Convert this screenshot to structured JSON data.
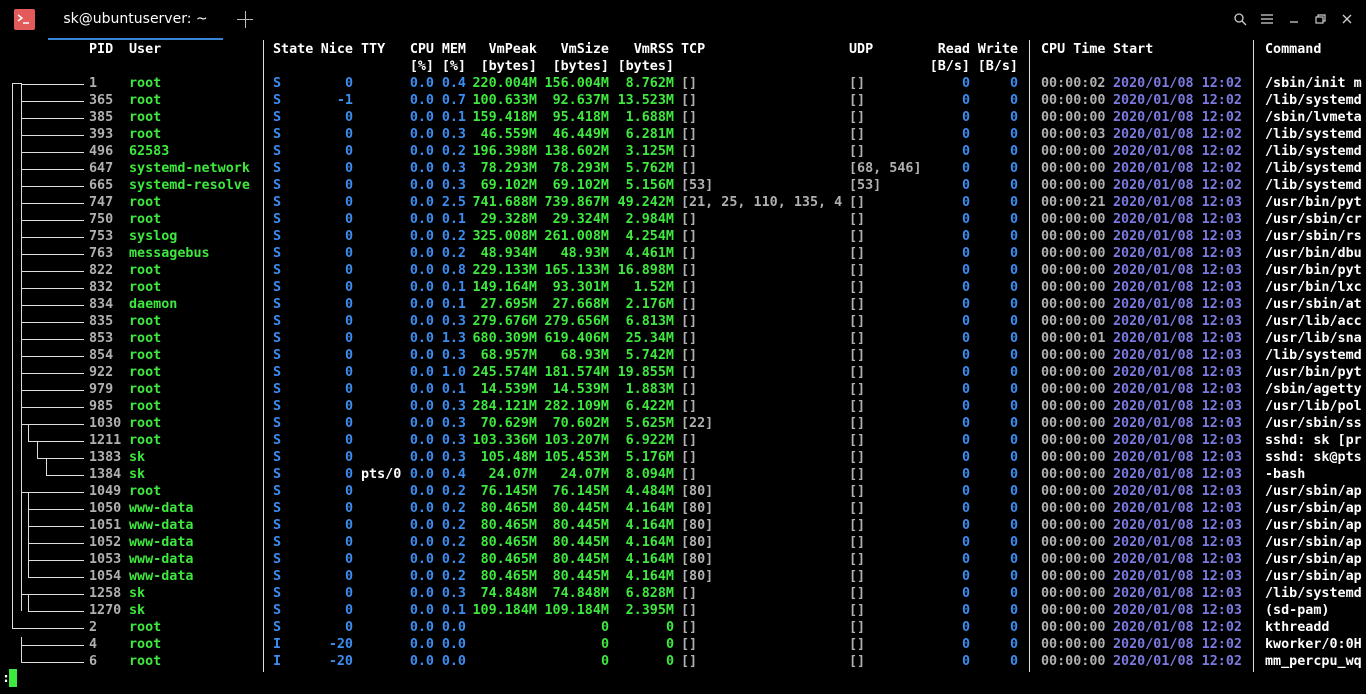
{
  "tab": {
    "title": "sk@ubuntuserver: ~"
  },
  "window_controls": {
    "search": "⌕",
    "menu": "☰",
    "minimize": "—",
    "maximize": "❐",
    "close": "✕"
  },
  "header_top": {
    "pid": "PID",
    "user": "User",
    "state": "State",
    "nice": "Nice",
    "tty": "TTY",
    "cpu": "CPU",
    "mem": "MEM",
    "vmpeak": "VmPeak",
    "vmsize": "VmSize",
    "vmrss": "VmRSS",
    "tcp": "TCP",
    "udp": "UDP",
    "read": "Read",
    "write": "Write",
    "cputime": "CPU Time",
    "start": "Start",
    "command": "Command"
  },
  "header_units": {
    "cpu": "[%]",
    "mem": "[%]",
    "vmpeak": "[bytes]",
    "vmsize": "[bytes]",
    "vmrss": "[bytes]",
    "read": "[B/s]",
    "write": "[B/s]"
  },
  "rows": [
    {
      "pid": "1",
      "user": "root",
      "state": "S",
      "nice": "0",
      "tty": "",
      "cpu": "0.0",
      "mem": "0.4",
      "vmpeak": "220.004M",
      "vmsize": "156.004M",
      "vmrss": "8.762M",
      "tcp": "[]",
      "udp": "[]",
      "read": "0",
      "write": "0",
      "cputime": "00:00:02",
      "start": "2020/01/08 12:02",
      "command": "/sbin/init m"
    },
    {
      "pid": "365",
      "user": "root",
      "state": "S",
      "nice": "-1",
      "tty": "",
      "cpu": "0.0",
      "mem": "0.7",
      "vmpeak": "100.633M",
      "vmsize": "92.637M",
      "vmrss": "13.523M",
      "tcp": "[]",
      "udp": "[]",
      "read": "0",
      "write": "0",
      "cputime": "00:00:00",
      "start": "2020/01/08 12:02",
      "command": "/lib/systemd"
    },
    {
      "pid": "385",
      "user": "root",
      "state": "S",
      "nice": "0",
      "tty": "",
      "cpu": "0.0",
      "mem": "0.1",
      "vmpeak": "159.418M",
      "vmsize": "95.418M",
      "vmrss": "1.688M",
      "tcp": "[]",
      "udp": "[]",
      "read": "0",
      "write": "0",
      "cputime": "00:00:00",
      "start": "2020/01/08 12:02",
      "command": "/sbin/lvmeta"
    },
    {
      "pid": "393",
      "user": "root",
      "state": "S",
      "nice": "0",
      "tty": "",
      "cpu": "0.0",
      "mem": "0.3",
      "vmpeak": "46.559M",
      "vmsize": "46.449M",
      "vmrss": "6.281M",
      "tcp": "[]",
      "udp": "[]",
      "read": "0",
      "write": "0",
      "cputime": "00:00:03",
      "start": "2020/01/08 12:02",
      "command": "/lib/systemd"
    },
    {
      "pid": "496",
      "user": "62583",
      "state": "S",
      "nice": "0",
      "tty": "",
      "cpu": "0.0",
      "mem": "0.2",
      "vmpeak": "196.398M",
      "vmsize": "138.602M",
      "vmrss": "3.125M",
      "tcp": "[]",
      "udp": "[]",
      "read": "0",
      "write": "0",
      "cputime": "00:00:00",
      "start": "2020/01/08 12:02",
      "command": "/lib/systemd"
    },
    {
      "pid": "647",
      "user": "systemd-network",
      "state": "S",
      "nice": "0",
      "tty": "",
      "cpu": "0.0",
      "mem": "0.3",
      "vmpeak": "78.293M",
      "vmsize": "78.293M",
      "vmrss": "5.762M",
      "tcp": "[]",
      "udp": "[68, 546]",
      "read": "0",
      "write": "0",
      "cputime": "00:00:00",
      "start": "2020/01/08 12:02",
      "command": "/lib/systemd"
    },
    {
      "pid": "665",
      "user": "systemd-resolve",
      "state": "S",
      "nice": "0",
      "tty": "",
      "cpu": "0.0",
      "mem": "0.3",
      "vmpeak": "69.102M",
      "vmsize": "69.102M",
      "vmrss": "5.156M",
      "tcp": "[53]",
      "udp": "[53]",
      "read": "0",
      "write": "0",
      "cputime": "00:00:00",
      "start": "2020/01/08 12:02",
      "command": "/lib/systemd"
    },
    {
      "pid": "747",
      "user": "root",
      "state": "S",
      "nice": "0",
      "tty": "",
      "cpu": "0.0",
      "mem": "2.5",
      "vmpeak": "741.688M",
      "vmsize": "739.867M",
      "vmrss": "49.242M",
      "tcp": "[21, 25, 110, 135, 4",
      "udp": "[]",
      "read": "0",
      "write": "0",
      "cputime": "00:00:21",
      "start": "2020/01/08 12:03",
      "command": "/usr/bin/pyt"
    },
    {
      "pid": "750",
      "user": "root",
      "state": "S",
      "nice": "0",
      "tty": "",
      "cpu": "0.0",
      "mem": "0.1",
      "vmpeak": "29.328M",
      "vmsize": "29.324M",
      "vmrss": "2.984M",
      "tcp": "[]",
      "udp": "[]",
      "read": "0",
      "write": "0",
      "cputime": "00:00:00",
      "start": "2020/01/08 12:03",
      "command": "/usr/sbin/cr"
    },
    {
      "pid": "753",
      "user": "syslog",
      "state": "S",
      "nice": "0",
      "tty": "",
      "cpu": "0.0",
      "mem": "0.2",
      "vmpeak": "325.008M",
      "vmsize": "261.008M",
      "vmrss": "4.254M",
      "tcp": "[]",
      "udp": "[]",
      "read": "0",
      "write": "0",
      "cputime": "00:00:00",
      "start": "2020/01/08 12:03",
      "command": "/usr/sbin/rs"
    },
    {
      "pid": "763",
      "user": "messagebus",
      "state": "S",
      "nice": "0",
      "tty": "",
      "cpu": "0.0",
      "mem": "0.2",
      "vmpeak": "48.934M",
      "vmsize": "48.93M",
      "vmrss": "4.461M",
      "tcp": "[]",
      "udp": "[]",
      "read": "0",
      "write": "0",
      "cputime": "00:00:00",
      "start": "2020/01/08 12:03",
      "command": "/usr/bin/dbu"
    },
    {
      "pid": "822",
      "user": "root",
      "state": "S",
      "nice": "0",
      "tty": "",
      "cpu": "0.0",
      "mem": "0.8",
      "vmpeak": "229.133M",
      "vmsize": "165.133M",
      "vmrss": "16.898M",
      "tcp": "[]",
      "udp": "[]",
      "read": "0",
      "write": "0",
      "cputime": "00:00:00",
      "start": "2020/01/08 12:03",
      "command": "/usr/bin/pyt"
    },
    {
      "pid": "832",
      "user": "root",
      "state": "S",
      "nice": "0",
      "tty": "",
      "cpu": "0.0",
      "mem": "0.1",
      "vmpeak": "149.164M",
      "vmsize": "93.301M",
      "vmrss": "1.52M",
      "tcp": "[]",
      "udp": "[]",
      "read": "0",
      "write": "0",
      "cputime": "00:00:00",
      "start": "2020/01/08 12:03",
      "command": "/usr/bin/lxc"
    },
    {
      "pid": "834",
      "user": "daemon",
      "state": "S",
      "nice": "0",
      "tty": "",
      "cpu": "0.0",
      "mem": "0.1",
      "vmpeak": "27.695M",
      "vmsize": "27.668M",
      "vmrss": "2.176M",
      "tcp": "[]",
      "udp": "[]",
      "read": "0",
      "write": "0",
      "cputime": "00:00:00",
      "start": "2020/01/08 12:03",
      "command": "/usr/sbin/at"
    },
    {
      "pid": "835",
      "user": "root",
      "state": "S",
      "nice": "0",
      "tty": "",
      "cpu": "0.0",
      "mem": "0.3",
      "vmpeak": "279.676M",
      "vmsize": "279.656M",
      "vmrss": "6.813M",
      "tcp": "[]",
      "udp": "[]",
      "read": "0",
      "write": "0",
      "cputime": "00:00:00",
      "start": "2020/01/08 12:03",
      "command": "/usr/lib/acc"
    },
    {
      "pid": "853",
      "user": "root",
      "state": "S",
      "nice": "0",
      "tty": "",
      "cpu": "0.0",
      "mem": "1.3",
      "vmpeak": "680.309M",
      "vmsize": "619.406M",
      "vmrss": "25.34M",
      "tcp": "[]",
      "udp": "[]",
      "read": "0",
      "write": "0",
      "cputime": "00:00:01",
      "start": "2020/01/08 12:03",
      "command": "/usr/lib/sna"
    },
    {
      "pid": "854",
      "user": "root",
      "state": "S",
      "nice": "0",
      "tty": "",
      "cpu": "0.0",
      "mem": "0.3",
      "vmpeak": "68.957M",
      "vmsize": "68.93M",
      "vmrss": "5.742M",
      "tcp": "[]",
      "udp": "[]",
      "read": "0",
      "write": "0",
      "cputime": "00:00:00",
      "start": "2020/01/08 12:03",
      "command": "/lib/systemd"
    },
    {
      "pid": "922",
      "user": "root",
      "state": "S",
      "nice": "0",
      "tty": "",
      "cpu": "0.0",
      "mem": "1.0",
      "vmpeak": "245.574M",
      "vmsize": "181.574M",
      "vmrss": "19.855M",
      "tcp": "[]",
      "udp": "[]",
      "read": "0",
      "write": "0",
      "cputime": "00:00:00",
      "start": "2020/01/08 12:03",
      "command": "/usr/bin/pyt"
    },
    {
      "pid": "979",
      "user": "root",
      "state": "S",
      "nice": "0",
      "tty": "",
      "cpu": "0.0",
      "mem": "0.1",
      "vmpeak": "14.539M",
      "vmsize": "14.539M",
      "vmrss": "1.883M",
      "tcp": "[]",
      "udp": "[]",
      "read": "0",
      "write": "0",
      "cputime": "00:00:00",
      "start": "2020/01/08 12:03",
      "command": "/sbin/agetty"
    },
    {
      "pid": "985",
      "user": "root",
      "state": "S",
      "nice": "0",
      "tty": "",
      "cpu": "0.0",
      "mem": "0.3",
      "vmpeak": "284.121M",
      "vmsize": "282.109M",
      "vmrss": "6.422M",
      "tcp": "[]",
      "udp": "[]",
      "read": "0",
      "write": "0",
      "cputime": "00:00:00",
      "start": "2020/01/08 12:03",
      "command": "/usr/lib/pol"
    },
    {
      "pid": "1030",
      "user": "root",
      "state": "S",
      "nice": "0",
      "tty": "",
      "cpu": "0.0",
      "mem": "0.3",
      "vmpeak": "70.629M",
      "vmsize": "70.602M",
      "vmrss": "5.625M",
      "tcp": "[22]",
      "udp": "[]",
      "read": "0",
      "write": "0",
      "cputime": "00:00:00",
      "start": "2020/01/08 12:03",
      "command": "/usr/sbin/ss"
    },
    {
      "pid": "1211",
      "user": "root",
      "state": "S",
      "nice": "0",
      "tty": "",
      "cpu": "0.0",
      "mem": "0.3",
      "vmpeak": "103.336M",
      "vmsize": "103.207M",
      "vmrss": "6.922M",
      "tcp": "[]",
      "udp": "[]",
      "read": "0",
      "write": "0",
      "cputime": "00:00:00",
      "start": "2020/01/08 12:03",
      "command": "sshd: sk [pr"
    },
    {
      "pid": "1383",
      "user": "sk",
      "state": "S",
      "nice": "0",
      "tty": "",
      "cpu": "0.0",
      "mem": "0.3",
      "vmpeak": "105.48M",
      "vmsize": "105.453M",
      "vmrss": "5.176M",
      "tcp": "[]",
      "udp": "[]",
      "read": "0",
      "write": "0",
      "cputime": "00:00:00",
      "start": "2020/01/08 12:03",
      "command": "sshd: sk@pts"
    },
    {
      "pid": "1384",
      "user": "sk",
      "state": "S",
      "nice": "0",
      "tty": "pts/0",
      "cpu": "0.0",
      "mem": "0.4",
      "vmpeak": "24.07M",
      "vmsize": "24.07M",
      "vmrss": "8.094M",
      "tcp": "[]",
      "udp": "[]",
      "read": "0",
      "write": "0",
      "cputime": "00:00:00",
      "start": "2020/01/08 12:03",
      "command": "-bash"
    },
    {
      "pid": "1049",
      "user": "root",
      "state": "S",
      "nice": "0",
      "tty": "",
      "cpu": "0.0",
      "mem": "0.2",
      "vmpeak": "76.145M",
      "vmsize": "76.145M",
      "vmrss": "4.484M",
      "tcp": "[80]",
      "udp": "[]",
      "read": "0",
      "write": "0",
      "cputime": "00:00:00",
      "start": "2020/01/08 12:03",
      "command": "/usr/sbin/ap"
    },
    {
      "pid": "1050",
      "user": "www-data",
      "state": "S",
      "nice": "0",
      "tty": "",
      "cpu": "0.0",
      "mem": "0.2",
      "vmpeak": "80.465M",
      "vmsize": "80.445M",
      "vmrss": "4.164M",
      "tcp": "[80]",
      "udp": "[]",
      "read": "0",
      "write": "0",
      "cputime": "00:00:00",
      "start": "2020/01/08 12:03",
      "command": "/usr/sbin/ap"
    },
    {
      "pid": "1051",
      "user": "www-data",
      "state": "S",
      "nice": "0",
      "tty": "",
      "cpu": "0.0",
      "mem": "0.2",
      "vmpeak": "80.465M",
      "vmsize": "80.445M",
      "vmrss": "4.164M",
      "tcp": "[80]",
      "udp": "[]",
      "read": "0",
      "write": "0",
      "cputime": "00:00:00",
      "start": "2020/01/08 12:03",
      "command": "/usr/sbin/ap"
    },
    {
      "pid": "1052",
      "user": "www-data",
      "state": "S",
      "nice": "0",
      "tty": "",
      "cpu": "0.0",
      "mem": "0.2",
      "vmpeak": "80.465M",
      "vmsize": "80.445M",
      "vmrss": "4.164M",
      "tcp": "[80]",
      "udp": "[]",
      "read": "0",
      "write": "0",
      "cputime": "00:00:00",
      "start": "2020/01/08 12:03",
      "command": "/usr/sbin/ap"
    },
    {
      "pid": "1053",
      "user": "www-data",
      "state": "S",
      "nice": "0",
      "tty": "",
      "cpu": "0.0",
      "mem": "0.2",
      "vmpeak": "80.465M",
      "vmsize": "80.445M",
      "vmrss": "4.164M",
      "tcp": "[80]",
      "udp": "[]",
      "read": "0",
      "write": "0",
      "cputime": "00:00:00",
      "start": "2020/01/08 12:03",
      "command": "/usr/sbin/ap"
    },
    {
      "pid": "1054",
      "user": "www-data",
      "state": "S",
      "nice": "0",
      "tty": "",
      "cpu": "0.0",
      "mem": "0.2",
      "vmpeak": "80.465M",
      "vmsize": "80.445M",
      "vmrss": "4.164M",
      "tcp": "[80]",
      "udp": "[]",
      "read": "0",
      "write": "0",
      "cputime": "00:00:00",
      "start": "2020/01/08 12:03",
      "command": "/usr/sbin/ap"
    },
    {
      "pid": "1258",
      "user": "sk",
      "state": "S",
      "nice": "0",
      "tty": "",
      "cpu": "0.0",
      "mem": "0.3",
      "vmpeak": "74.848M",
      "vmsize": "74.848M",
      "vmrss": "6.828M",
      "tcp": "[]",
      "udp": "[]",
      "read": "0",
      "write": "0",
      "cputime": "00:00:00",
      "start": "2020/01/08 12:03",
      "command": "/lib/systemd"
    },
    {
      "pid": "1270",
      "user": "sk",
      "state": "S",
      "nice": "0",
      "tty": "",
      "cpu": "0.0",
      "mem": "0.1",
      "vmpeak": "109.184M",
      "vmsize": "109.184M",
      "vmrss": "2.395M",
      "tcp": "[]",
      "udp": "[]",
      "read": "0",
      "write": "0",
      "cputime": "00:00:00",
      "start": "2020/01/08 12:03",
      "command": "(sd-pam)"
    },
    {
      "pid": "2",
      "user": "root",
      "state": "S",
      "nice": "0",
      "tty": "",
      "cpu": "0.0",
      "mem": "0.0",
      "vmpeak": "",
      "vmsize": "0",
      "vmrss": "0",
      "tcp": "[]",
      "udp": "[]",
      "read": "0",
      "write": "0",
      "cputime": "00:00:00",
      "start": "2020/01/08 12:02",
      "command": "kthreadd"
    },
    {
      "pid": "4",
      "user": "root",
      "state": "I",
      "nice": "-20",
      "tty": "",
      "cpu": "0.0",
      "mem": "0.0",
      "vmpeak": "",
      "vmsize": "0",
      "vmrss": "0",
      "tcp": "[]",
      "udp": "[]",
      "read": "0",
      "write": "0",
      "cputime": "00:00:00",
      "start": "2020/01/08 12:02",
      "command": "kworker/0:0H"
    },
    {
      "pid": "6",
      "user": "root",
      "state": "I",
      "nice": "-20",
      "tty": "",
      "cpu": "0.0",
      "mem": "0.0",
      "vmpeak": "",
      "vmsize": "0",
      "vmrss": "0",
      "tcp": "[]",
      "udp": "[]",
      "read": "0",
      "write": "0",
      "cputime": "00:00:00",
      "start": "2020/01/08 12:02",
      "command": "mm_percpu_wq"
    }
  ],
  "prompt": {
    "text": ":"
  },
  "colors": {
    "green": "#3ee83e",
    "blue": "#3b8df0",
    "date": "#7a7ae0",
    "accent_tab": "#3a84d4",
    "icon_bg": "#e35a5a"
  }
}
